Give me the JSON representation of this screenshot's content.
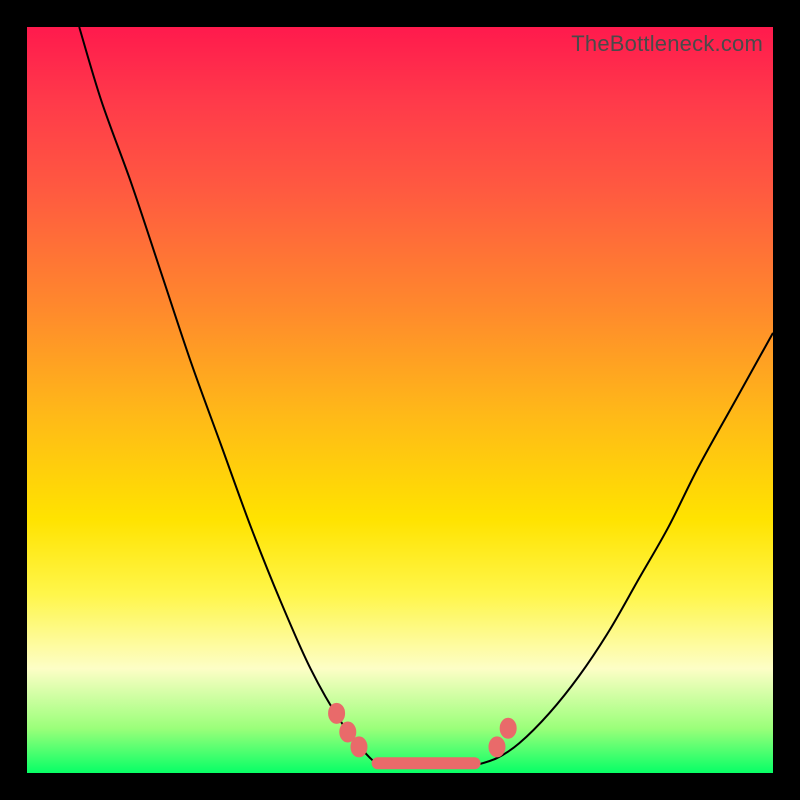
{
  "attribution": "TheBottleneck.com",
  "colors": {
    "frame": "#000000",
    "curve": "#000000",
    "marker": "#e96a6a",
    "gradient_stops": [
      "#ff1a4d",
      "#ff3a4a",
      "#ff5a40",
      "#ff8a2c",
      "#ffb918",
      "#ffe300",
      "#fff64a",
      "#fdfec6",
      "#9bff7a",
      "#07ff66"
    ]
  },
  "chart_data": {
    "type": "line",
    "title": "",
    "xlabel": "",
    "ylabel": "",
    "xlim": [
      0,
      100
    ],
    "ylim": [
      0,
      100
    ],
    "grid": false,
    "legend": false,
    "series": [
      {
        "name": "left-curve",
        "x": [
          7,
          10,
          14,
          18,
          22,
          26,
          30,
          34,
          38,
          42,
          46,
          48
        ],
        "values": [
          100,
          90,
          79,
          67,
          55,
          44,
          33,
          23,
          14,
          7,
          2,
          1
        ]
      },
      {
        "name": "right-curve",
        "x": [
          60,
          63,
          66,
          70,
          74,
          78,
          82,
          86,
          90,
          95,
          100
        ],
        "values": [
          1,
          2,
          4,
          8,
          13,
          19,
          26,
          33,
          41,
          50,
          59
        ]
      },
      {
        "name": "valley-floor",
        "x": [
          48,
          60
        ],
        "values": [
          1,
          1
        ]
      }
    ],
    "markers": [
      {
        "x": 41.5,
        "y": 8.0
      },
      {
        "x": 43.0,
        "y": 5.5
      },
      {
        "x": 44.5,
        "y": 3.5
      },
      {
        "x": 63.0,
        "y": 3.5
      },
      {
        "x": 64.5,
        "y": 6.0
      }
    ],
    "marker_line": {
      "x": [
        47,
        60
      ],
      "values": [
        1.3,
        1.3
      ]
    }
  }
}
